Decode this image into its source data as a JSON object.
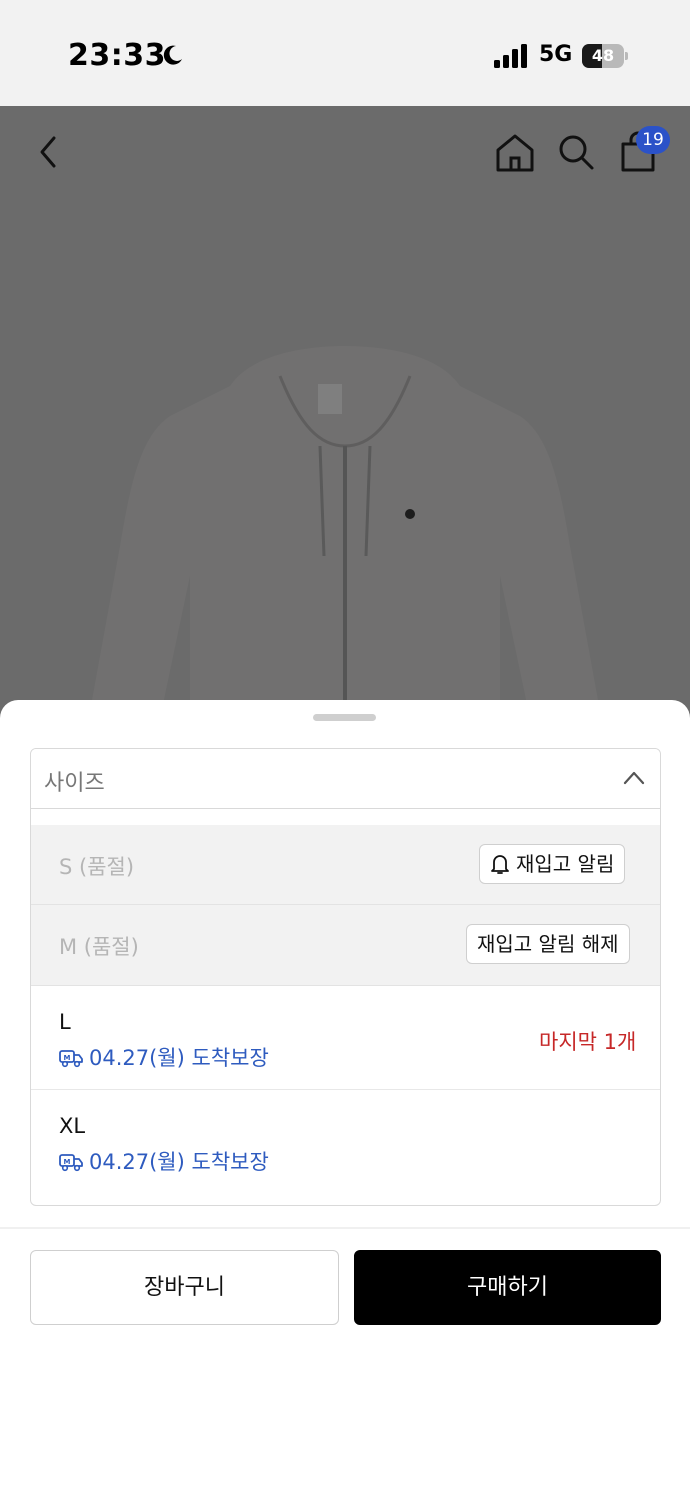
{
  "status_bar": {
    "time": "23:33",
    "network": "5G",
    "battery": "48",
    "battery_level": 0.48
  },
  "header": {
    "cart_count": "19"
  },
  "icons": {
    "back": "chevron-left-icon",
    "home": "home-icon",
    "search": "search-icon",
    "cart": "shopping-bag-icon",
    "expand": "chevron-up-icon",
    "bell": "bell-icon",
    "delivery": "truck-icon"
  },
  "size_selector": {
    "label": "사이즈",
    "options": [
      {
        "label": "S (품절)",
        "sold_out": true,
        "action": "재입고 알림"
      },
      {
        "label": "M (품절)",
        "sold_out": true,
        "action": "재입고 알림 해제"
      },
      {
        "label": "L",
        "sold_out": false,
        "delivery": "04.27(월) 도착보장",
        "note": "마지막 1개"
      },
      {
        "label": "XL",
        "sold_out": false,
        "delivery": "04.27(월) 도착보장"
      }
    ]
  },
  "actions": {
    "cart": "장바구니",
    "buy": "구매하기"
  },
  "colors": {
    "accent_blue": "#2e5bbf",
    "badge_blue": "#2b52c8",
    "warning_red": "#c62828",
    "primary_button": "#000000",
    "overlay": "#6b6b6b"
  }
}
